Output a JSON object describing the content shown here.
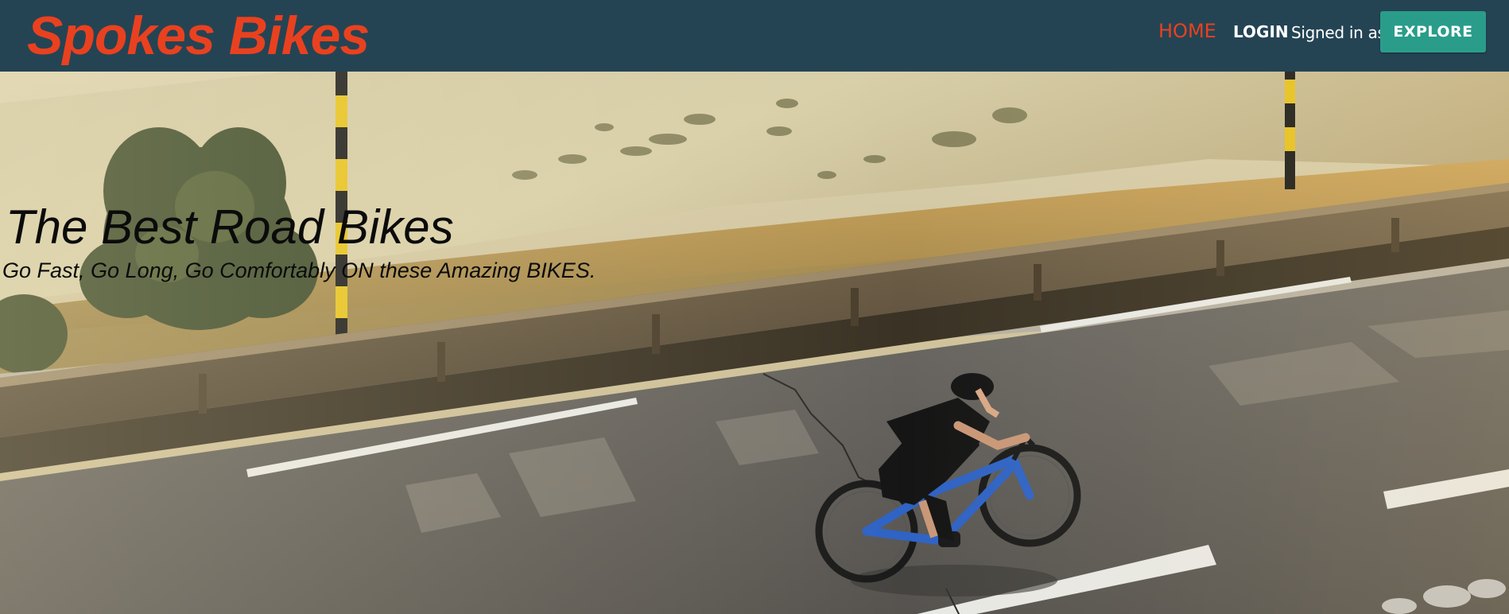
{
  "navbar": {
    "brand": "Spokes Bikes",
    "home_label": "HOME",
    "login_label": "LOGIN",
    "signed_in_label": "Signed in as:",
    "explore_label": "EXPLORE"
  },
  "hero": {
    "title": "The Best Road Bikes",
    "subtitle": "Go Fast, Go Long, Go Comfortably ON these Amazing BIKES.",
    "image": "road-cyclist-mountain-photo"
  },
  "colors": {
    "navbar_bg": "#244454",
    "brand": "#e9411f",
    "active_link": "#e9411f",
    "explore_button": "#2a9d8a"
  }
}
